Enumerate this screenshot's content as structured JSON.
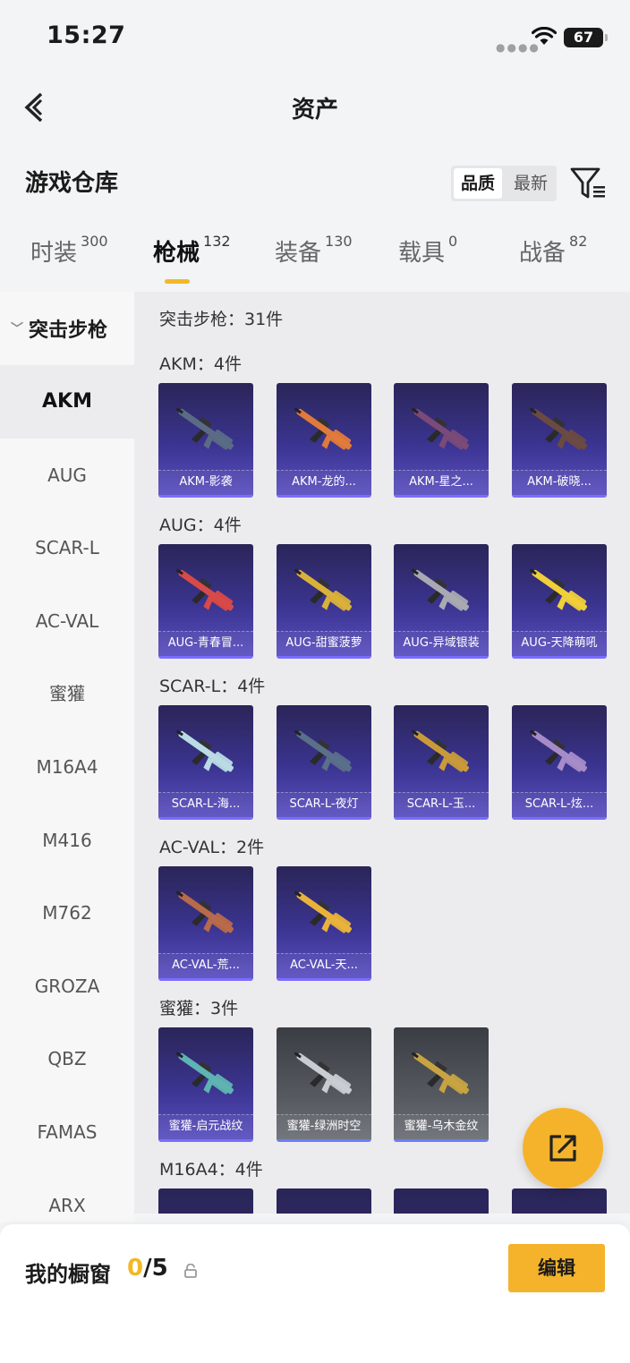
{
  "status": {
    "time": "15:27",
    "battery": "67"
  },
  "nav": {
    "title": "资产"
  },
  "header": {
    "title": "游戏仓库",
    "sort_options": [
      "品质",
      "最新"
    ]
  },
  "tabs": [
    {
      "label": "时装",
      "count": "300"
    },
    {
      "label": "枪械",
      "count": "132"
    },
    {
      "label": "装备",
      "count": "130"
    },
    {
      "label": "载具",
      "count": "0"
    },
    {
      "label": "战备",
      "count": "82"
    }
  ],
  "sidebar": {
    "group": "突击步枪",
    "items": [
      "AKM",
      "AUG",
      "SCAR-L",
      "AC-VAL",
      "蜜獾",
      "M16A4",
      "M416",
      "M762",
      "GROZA",
      "QBZ",
      "FAMAS",
      "ARX"
    ]
  },
  "content": {
    "summary": "突击步枪：31件",
    "sections": [
      {
        "header": "AKM：4件",
        "items": [
          {
            "name": "AKM-影袭",
            "gun_color": "#5b6b86"
          },
          {
            "name": "AKM-龙的...",
            "gun_color": "#e07a3a"
          },
          {
            "name": "AKM-星之...",
            "gun_color": "#7a4a78"
          },
          {
            "name": "AKM-破晓...",
            "gun_color": "#6b4a42"
          }
        ]
      },
      {
        "header": "AUG：4件",
        "items": [
          {
            "name": "AUG-青春冒...",
            "gun_color": "#d84a48"
          },
          {
            "name": "AUG-甜蜜菠萝",
            "gun_color": "#d9b13a"
          },
          {
            "name": "AUG-异域银装",
            "gun_color": "#a9a9b2"
          },
          {
            "name": "AUG-天降萌吼",
            "gun_color": "#f0cf3a"
          }
        ]
      },
      {
        "header": "SCAR-L：4件",
        "items": [
          {
            "name": "SCAR-L-海...",
            "gun_color": "#b9dbe4"
          },
          {
            "name": "SCAR-L-夜灯",
            "gun_color": "#5a6f8a"
          },
          {
            "name": "SCAR-L-玉...",
            "gun_color": "#c99a3a"
          },
          {
            "name": "SCAR-L-炫...",
            "gun_color": "#a58cc8"
          }
        ]
      },
      {
        "header": "AC-VAL：2件",
        "items": [
          {
            "name": "AC-VAL-荒...",
            "gun_color": "#b86a4a"
          },
          {
            "name": "AC-VAL-天...",
            "gun_color": "#e9b23a"
          }
        ]
      },
      {
        "header": "蜜獾：3件",
        "items": [
          {
            "name": "蜜獾-启元战纹",
            "gun_color": "#5fb3b2",
            "grey": false
          },
          {
            "name": "蜜獾-绿洲时空",
            "gun_color": "#c9ccd1",
            "grey": true
          },
          {
            "name": "蜜獾-乌木金纹",
            "gun_color": "#c8a341",
            "grey": true
          }
        ]
      },
      {
        "header": "M16A4：4件",
        "items": []
      }
    ]
  },
  "bottom": {
    "label": "我的橱窗",
    "current": "0",
    "total": "/5",
    "edit": "编辑"
  },
  "colors": {
    "accent": "#f4b32b",
    "card_top": "#2a2558",
    "card_bottom": "#5a4fc0"
  }
}
